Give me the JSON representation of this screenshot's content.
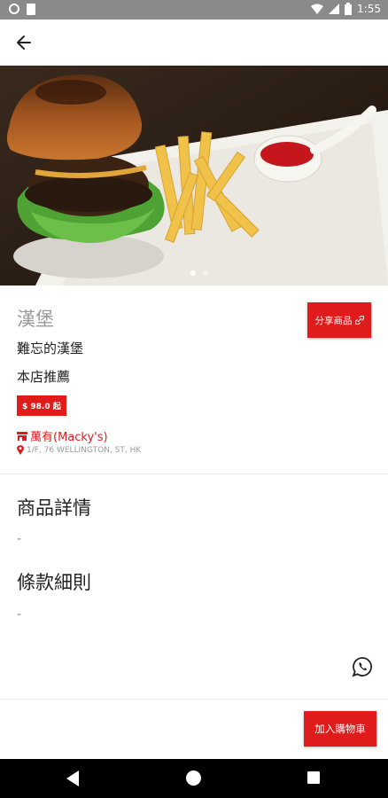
{
  "status_bar": {
    "time": "1:55",
    "icons": [
      "circle-notification-icon",
      "document-icon",
      "wifi-icon",
      "signal-icon",
      "battery-icon"
    ]
  },
  "app_bar": {
    "back_icon": "arrow-back-icon"
  },
  "hero_image": {
    "description_icon": "burger-photo",
    "carousel_dots": 2,
    "active_dot": 1
  },
  "product": {
    "name": "漢堡",
    "subtitle": "難忘的漢堡",
    "tag": "本店推薦",
    "price": "$ 98.0 起",
    "share_label": "分享商品",
    "store_name": "萬有(Macky's)",
    "address": "1/F, 76 WELLINGTON, ST, HK"
  },
  "sections": {
    "details_title": "商品詳情",
    "details_body": "-",
    "terms_title": "條款細則",
    "terms_body": "-"
  },
  "actions": {
    "add_to_cart": "加入購物車"
  },
  "colors": {
    "accent": "#e01b1b",
    "status_bar": "#8a8a8a",
    "nav_bar": "#000000"
  }
}
